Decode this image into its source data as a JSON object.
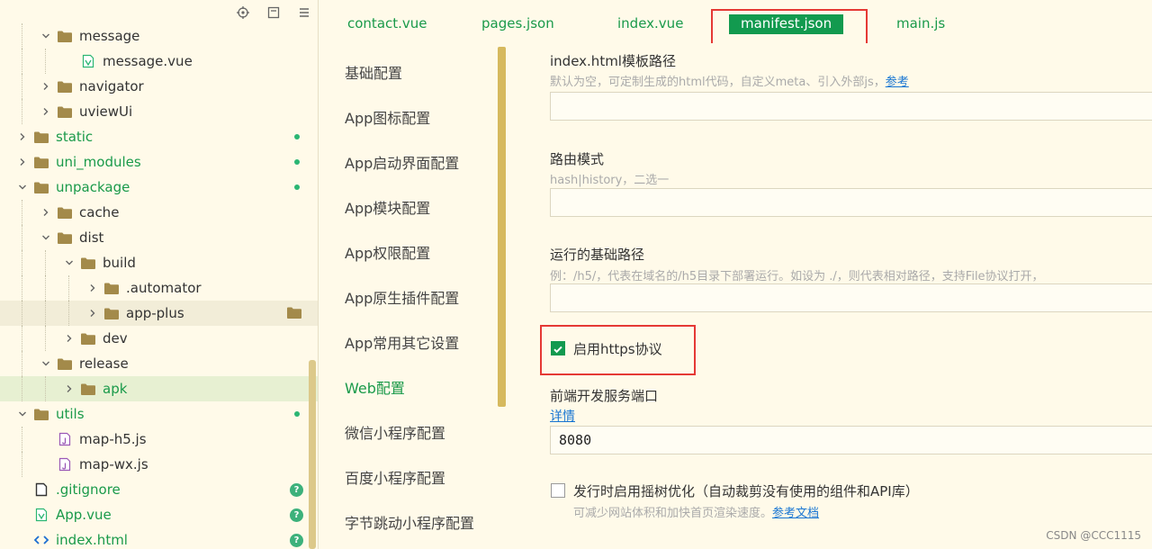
{
  "explorer": {
    "rows": [
      {
        "label": "message",
        "depth": 1,
        "chevron": "down",
        "icon": "folder",
        "color": "normal"
      },
      {
        "label": "message.vue",
        "depth": 2,
        "chevron": "",
        "icon": "vue",
        "color": "normal"
      },
      {
        "label": "navigator",
        "depth": 1,
        "chevron": "right",
        "icon": "folder",
        "color": "normal"
      },
      {
        "label": "uviewUi",
        "depth": 1,
        "chevron": "right",
        "icon": "folder",
        "color": "normal"
      },
      {
        "label": "static",
        "depth": 0,
        "chevron": "right",
        "icon": "folder",
        "color": "green",
        "dot": true
      },
      {
        "label": "uni_modules",
        "depth": 0,
        "chevron": "right",
        "icon": "folder",
        "color": "green",
        "dot": true
      },
      {
        "label": "unpackage",
        "depth": 0,
        "chevron": "down",
        "icon": "folder",
        "color": "green",
        "dot": true
      },
      {
        "label": "cache",
        "depth": 1,
        "chevron": "right",
        "icon": "folder",
        "color": "normal"
      },
      {
        "label": "dist",
        "depth": 1,
        "chevron": "down",
        "icon": "folder",
        "color": "normal"
      },
      {
        "label": "build",
        "depth": 2,
        "chevron": "down",
        "icon": "folder",
        "color": "normal"
      },
      {
        "label": ".automator",
        "depth": 3,
        "chevron": "right",
        "icon": "folder",
        "color": "normal"
      },
      {
        "label": "app-plus",
        "depth": 3,
        "chevron": "right",
        "icon": "folder",
        "color": "normal",
        "highlight": true
      },
      {
        "label": "dev",
        "depth": 2,
        "chevron": "right",
        "icon": "folder",
        "color": "normal"
      },
      {
        "label": "release",
        "depth": 1,
        "chevron": "down",
        "icon": "folder",
        "color": "normal"
      },
      {
        "label": "apk",
        "depth": 2,
        "chevron": "right",
        "icon": "folder",
        "color": "green",
        "active": true
      },
      {
        "label": "utils",
        "depth": 0,
        "chevron": "down",
        "icon": "folder",
        "color": "green",
        "dot": true
      },
      {
        "label": "map-h5.js",
        "depth": 1,
        "chevron": "",
        "icon": "js",
        "color": "normal"
      },
      {
        "label": "map-wx.js",
        "depth": 1,
        "chevron": "",
        "icon": "js",
        "color": "normal"
      },
      {
        "label": ".gitignore",
        "depth": 0,
        "chevron": "",
        "icon": "file",
        "color": "green",
        "badge": "?"
      },
      {
        "label": "App.vue",
        "depth": 0,
        "chevron": "",
        "icon": "vue",
        "color": "green",
        "badge": "?"
      },
      {
        "label": "index.html",
        "depth": 0,
        "chevron": "",
        "icon": "html",
        "color": "green",
        "badge": "?"
      }
    ]
  },
  "tabs": [
    {
      "label": "contact.vue",
      "active": false
    },
    {
      "label": "pages.json",
      "active": false
    },
    {
      "label": "index.vue",
      "active": false
    },
    {
      "label": "manifest.json",
      "active": true
    },
    {
      "label": "main.js",
      "active": false
    }
  ],
  "settings_nav": {
    "items": [
      {
        "label": "基础配置",
        "active": false
      },
      {
        "label": "App图标配置",
        "active": false
      },
      {
        "label": "App启动界面配置",
        "active": false
      },
      {
        "label": "App模块配置",
        "active": false
      },
      {
        "label": "App权限配置",
        "active": false
      },
      {
        "label": "App原生插件配置",
        "active": false
      },
      {
        "label": "App常用其它设置",
        "active": false
      },
      {
        "label": "Web配置",
        "active": true
      },
      {
        "label": "微信小程序配置",
        "active": false
      },
      {
        "label": "百度小程序配置",
        "active": false
      },
      {
        "label": "字节跳动小程序配置",
        "active": false
      }
    ]
  },
  "form": {
    "template_path": {
      "label": "index.html模板路径",
      "hint": "默认为空，可定制生成的html代码，自定义meta、引入外部js，",
      "hint_link": "参考",
      "value": ""
    },
    "router_mode": {
      "label": "路由模式",
      "hint": "hash|history，二选一",
      "value": ""
    },
    "base_path": {
      "label": "运行的基础路径",
      "hint": "例：/h5/，代表在域名的/h5目录下部署运行。如设为 ./，则代表相对路径，支持File协议打开，",
      "value": ""
    },
    "https": {
      "label": "启用https协议",
      "checked": true
    },
    "dev_port": {
      "label": "前端开发服务端口",
      "link": "详情",
      "value": "8080"
    },
    "tree_shaking": {
      "label": "发行时启用摇树优化（自动裁剪没有使用的组件和API库）",
      "checked": false,
      "hint": "可减少网站体积和加快首页渲染速度。",
      "hint_link": "参考文档"
    }
  },
  "watermark": "CSDN @CCC1115",
  "colors": {
    "background": "#fffae9",
    "accent_green": "#129a4f",
    "highlight_red": "#e53935",
    "link_blue": "#1976d2"
  }
}
